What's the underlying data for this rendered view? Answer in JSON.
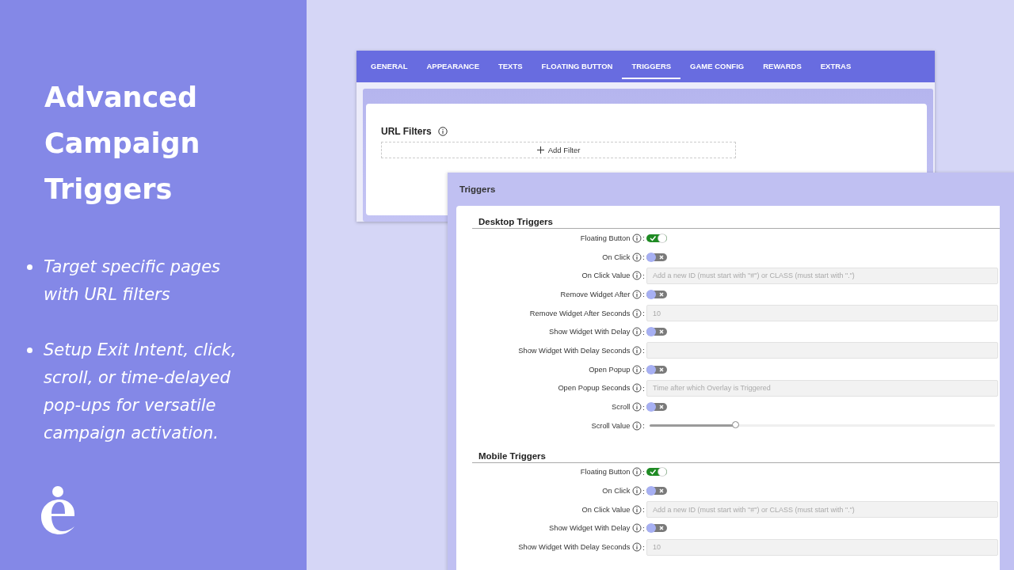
{
  "promo": {
    "title": "Advanced Campaign Triggers",
    "bullets": [
      "Target specific pages with URL filters",
      "Setup Exit Intent, click, scroll, or time-delayed pop-ups for versatile campaign activation."
    ]
  },
  "settings_window": {
    "tabs": [
      {
        "label": "GENERAL",
        "selected": false
      },
      {
        "label": "APPEARANCE",
        "selected": false
      },
      {
        "label": "TEXTS",
        "selected": false
      },
      {
        "label": "FLOATING BUTTON",
        "selected": false
      },
      {
        "label": "TRIGGERS",
        "selected": true
      },
      {
        "label": "GAME CONFIG",
        "selected": false
      },
      {
        "label": "REWARDS",
        "selected": false
      },
      {
        "label": "EXTRAS",
        "selected": false
      }
    ],
    "url_filters": {
      "title": "URL Filters",
      "add_button": "Add Filter"
    }
  },
  "triggers_panel": {
    "title": "Triggers",
    "sections": [
      {
        "title": "Desktop Triggers",
        "rows": [
          {
            "label": "Floating Button",
            "suffix": ":",
            "kind": "toggle",
            "on": true
          },
          {
            "label": "On Click",
            "suffix": ":",
            "kind": "toggle",
            "on": false
          },
          {
            "label": "On Click Value",
            "suffix": ":",
            "kind": "input",
            "placeholder": "Add a new ID (must start with \"#\") or CLASS (must start with \".\")"
          },
          {
            "label": "Remove Widget After",
            "suffix": ":",
            "kind": "toggle",
            "on": false
          },
          {
            "label": "Remove Widget After Seconds",
            "suffix": ":",
            "kind": "input",
            "placeholder": "10"
          },
          {
            "label": "Show Widget With Delay",
            "suffix": ":",
            "kind": "toggle",
            "on": false
          },
          {
            "label": "Show Widget With Delay Seconds",
            "suffix": ":",
            "kind": "input"
          },
          {
            "label": "Open Popup",
            "suffix": ":",
            "kind": "toggle",
            "on": false
          },
          {
            "label": "Open Popup Seconds",
            "suffix": ":",
            "kind": "input",
            "placeholder": "Time after which Overlay is Triggered"
          },
          {
            "label": "Scroll",
            "suffix": ":",
            "kind": "toggle",
            "on": false
          },
          {
            "label": "Scroll Value",
            "suffix": ":",
            "kind": "slider",
            "level": 0.25
          }
        ]
      },
      {
        "title": "Mobile Triggers",
        "rows": [
          {
            "label": "Floating Button",
            "suffix": ":",
            "kind": "toggle",
            "on": true
          },
          {
            "label": "On Click",
            "suffix": ":",
            "kind": "toggle",
            "on": false
          },
          {
            "label": "On Click Value",
            "suffix": ":",
            "kind": "input",
            "placeholder": "Add a new ID (must start with \"#\") or CLASS (must start with \".\")"
          },
          {
            "label": "Show Widget With Delay",
            "suffix": ":",
            "kind": "toggle",
            "on": false
          },
          {
            "label": "Show Widget With Delay Seconds",
            "suffix": ":",
            "kind": "input",
            "placeholder": "10"
          }
        ]
      }
    ]
  }
}
